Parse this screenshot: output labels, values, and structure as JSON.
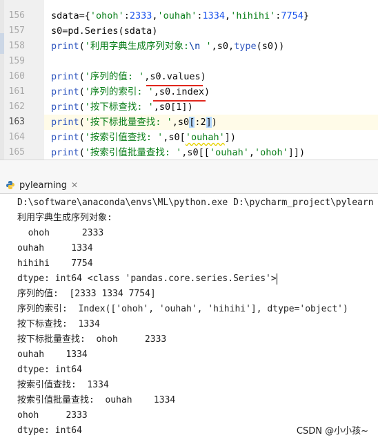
{
  "editor": {
    "line_numbers": [
      "156",
      "157",
      "158",
      "159",
      "160",
      "161",
      "162",
      "163",
      "164",
      "165"
    ],
    "active_line": "163",
    "lines": [
      [
        {
          "t": "sdata={",
          "c": "id"
        },
        {
          "t": "'ohoh'",
          "c": "str"
        },
        {
          "t": ":",
          "c": "id"
        },
        {
          "t": "2333",
          "c": "num"
        },
        {
          "t": ",",
          "c": "id"
        },
        {
          "t": "'ouhah'",
          "c": "str"
        },
        {
          "t": ":",
          "c": "id"
        },
        {
          "t": "1334",
          "c": "num"
        },
        {
          "t": ",",
          "c": "id"
        },
        {
          "t": "'hihihi'",
          "c": "str"
        },
        {
          "t": ":",
          "c": "id"
        },
        {
          "t": "7754",
          "c": "num"
        },
        {
          "t": "}",
          "c": "id"
        }
      ],
      [
        {
          "t": "s0=pd.Series(sdata)",
          "c": "id"
        }
      ],
      [
        {
          "t": "print",
          "c": "fn"
        },
        {
          "t": "(",
          "c": "id"
        },
        {
          "t": "'利用字典生成序列对象:",
          "c": "str"
        },
        {
          "t": "\\n",
          "c": "esc"
        },
        {
          "t": " '",
          "c": "str"
        },
        {
          "t": ",s0,",
          "c": "id"
        },
        {
          "t": "type",
          "c": "fn"
        },
        {
          "t": "(s0))",
          "c": "id"
        }
      ],
      [
        {
          "t": "",
          "c": "id"
        }
      ],
      [
        {
          "t": "print",
          "c": "fn"
        },
        {
          "t": "(",
          "c": "id"
        },
        {
          "t": "'序列的值: '",
          "c": "str"
        },
        {
          "t": ",s0.values)",
          "c": "id"
        }
      ],
      [
        {
          "t": "print",
          "c": "fn"
        },
        {
          "t": "(",
          "c": "id"
        },
        {
          "t": "'序列的索引: '",
          "c": "str"
        },
        {
          "t": ",s0.index)",
          "c": "id"
        }
      ],
      [
        {
          "t": "print",
          "c": "fn"
        },
        {
          "t": "(",
          "c": "id"
        },
        {
          "t": "'按下标查找: '",
          "c": "str"
        },
        {
          "t": ",s0[1])",
          "c": "id"
        }
      ],
      [
        {
          "t": "print",
          "c": "fn"
        },
        {
          "t": "(",
          "c": "id"
        },
        {
          "t": "'按下标批量查找: '",
          "c": "str"
        },
        {
          "t": ",s0",
          "c": "id"
        },
        {
          "t": "[",
          "c": "br"
        },
        {
          "t": ":2",
          "c": "id"
        },
        {
          "t": "]",
          "c": "br"
        },
        {
          "t": ")",
          "c": "id"
        }
      ],
      [
        {
          "t": "print",
          "c": "fn"
        },
        {
          "t": "(",
          "c": "id"
        },
        {
          "t": "'按索引值查找: '",
          "c": "str"
        },
        {
          "t": ",s0[",
          "c": "id"
        },
        {
          "t": "'ouhah'",
          "c": "str"
        },
        {
          "t": "])",
          "c": "id"
        }
      ],
      [
        {
          "t": "print",
          "c": "fn"
        },
        {
          "t": "(",
          "c": "id"
        },
        {
          "t": "'按索引值批量查找: '",
          "c": "str"
        },
        {
          "t": ",s0[[",
          "c": "id"
        },
        {
          "t": "'ouhah'",
          "c": "str"
        },
        {
          "t": ",",
          "c": "id"
        },
        {
          "t": "'ohoh'",
          "c": "str"
        },
        {
          "t": "]])",
          "c": "id"
        }
      ]
    ]
  },
  "run_panel": {
    "tab_label": "pylearning",
    "icon": "python-icon"
  },
  "console": {
    "lines": [
      "D:\\software\\anaconda\\envs\\ML\\python.exe D:\\pycharm_project\\pylearn",
      "利用字典生成序列对象:",
      "  ohoh      2333",
      "ouhah     1334",
      "hihihi    7754",
      "dtype: int64 <class 'pandas.core.series.Series'>",
      "序列的值:  [2333 1334 7754]",
      "序列的索引:  Index(['ohoh', 'ouhah', 'hihihi'], dtype='object')",
      "按下标查找:  1334",
      "按下标批量查找:  ohoh     2333",
      "ouhah    1334",
      "dtype: int64",
      "按索引值查找:  1334",
      "按索引值批量查找:  ouhah    1334",
      "ohoh     2333",
      "dtype: int64"
    ]
  },
  "watermark": "CSDN @小小孩~",
  "colors": {
    "string": "#077d17",
    "function": "#2f56bf",
    "number": "#1750eb",
    "annotation_underline": "#e0261c"
  }
}
